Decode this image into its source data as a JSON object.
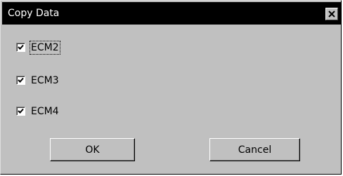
{
  "window": {
    "title": "Copy Data",
    "close_icon": "close-icon"
  },
  "checkboxes": [
    {
      "label": "ECM2",
      "checked": true,
      "focused": true
    },
    {
      "label": "ECM3",
      "checked": true,
      "focused": false
    },
    {
      "label": "ECM4",
      "checked": true,
      "focused": false
    }
  ],
  "buttons": {
    "ok_label": "OK",
    "cancel_label": "Cancel"
  },
  "colors": {
    "titlebar": "#000000",
    "dialog_face": "#c0c0c0",
    "title_text": "#ffffff"
  }
}
